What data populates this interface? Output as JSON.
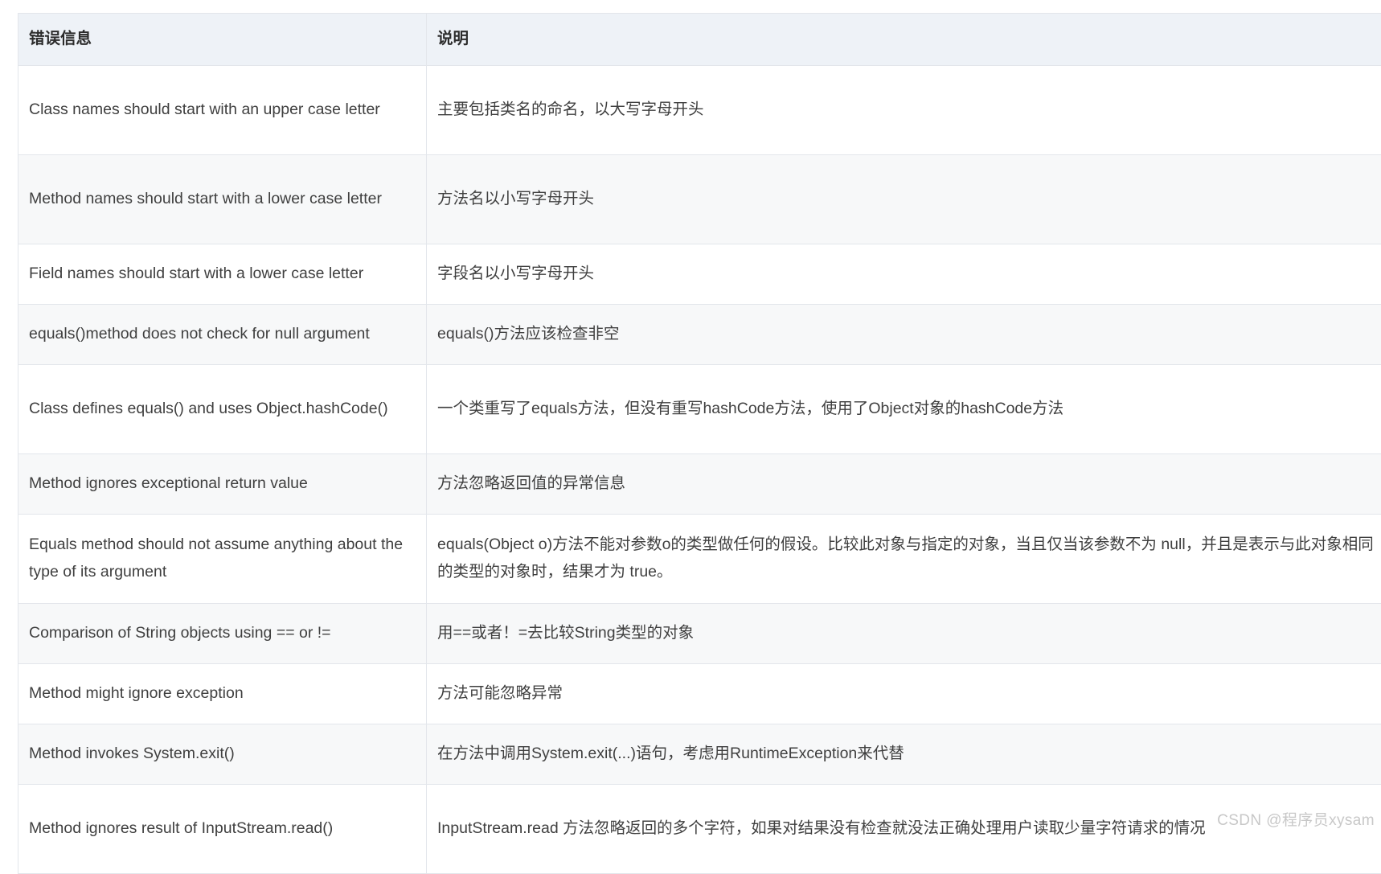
{
  "table": {
    "headers": [
      "错误信息",
      "说明"
    ],
    "rows": [
      {
        "error": "Class names should start with an upper case letter",
        "desc": "主要包括类名的命名，以大写字母开头"
      },
      {
        "error": "Method names should start with a lower case letter",
        "desc": "方法名以小写字母开头"
      },
      {
        "error": "Field names should start with a lower case letter",
        "desc": "字段名以小写字母开头"
      },
      {
        "error": "equals()method does not check for null argument",
        "desc": "equals()方法应该检查非空"
      },
      {
        "error": "Class defines equals() and uses Object.hashCode()",
        "desc": "一个类重写了equals方法，但没有重写hashCode方法，使用了Object对象的hashCode方法"
      },
      {
        "error": "Method ignores exceptional return value",
        "desc": "方法忽略返回值的异常信息"
      },
      {
        "error": "Equals method should not assume anything about the type of its argument",
        "desc": "equals(Object o)方法不能对参数o的类型做任何的假设。比较此对象与指定的对象，当且仅当该参数不为 null，并且是表示与此对象相同的类型的对象时，结果才为 true。"
      },
      {
        "error": "Comparison of String objects using == or !=",
        "desc": "用==或者！=去比较String类型的对象"
      },
      {
        "error": "Method might ignore exception",
        "desc": "方法可能忽略异常"
      },
      {
        "error": "Method invokes System.exit()",
        "desc": "在方法中调用System.exit(...)语句，考虑用RuntimeException来代替"
      },
      {
        "error": "Method ignores result of InputStream.read()",
        "desc": "InputStream.read 方法忽略返回的多个字符，如果对结果没有检查就没法正确处理用户读取少量字符请求的情况"
      }
    ]
  },
  "watermark": {
    "text": "CSDN @程序员xysam"
  },
  "colors": {
    "header_bg": "#eef2f7",
    "row_alt_bg": "#f7f8f9",
    "border": "#e3e6eb",
    "text": "#3f3f3f",
    "watermark": "#c8c8c8"
  }
}
